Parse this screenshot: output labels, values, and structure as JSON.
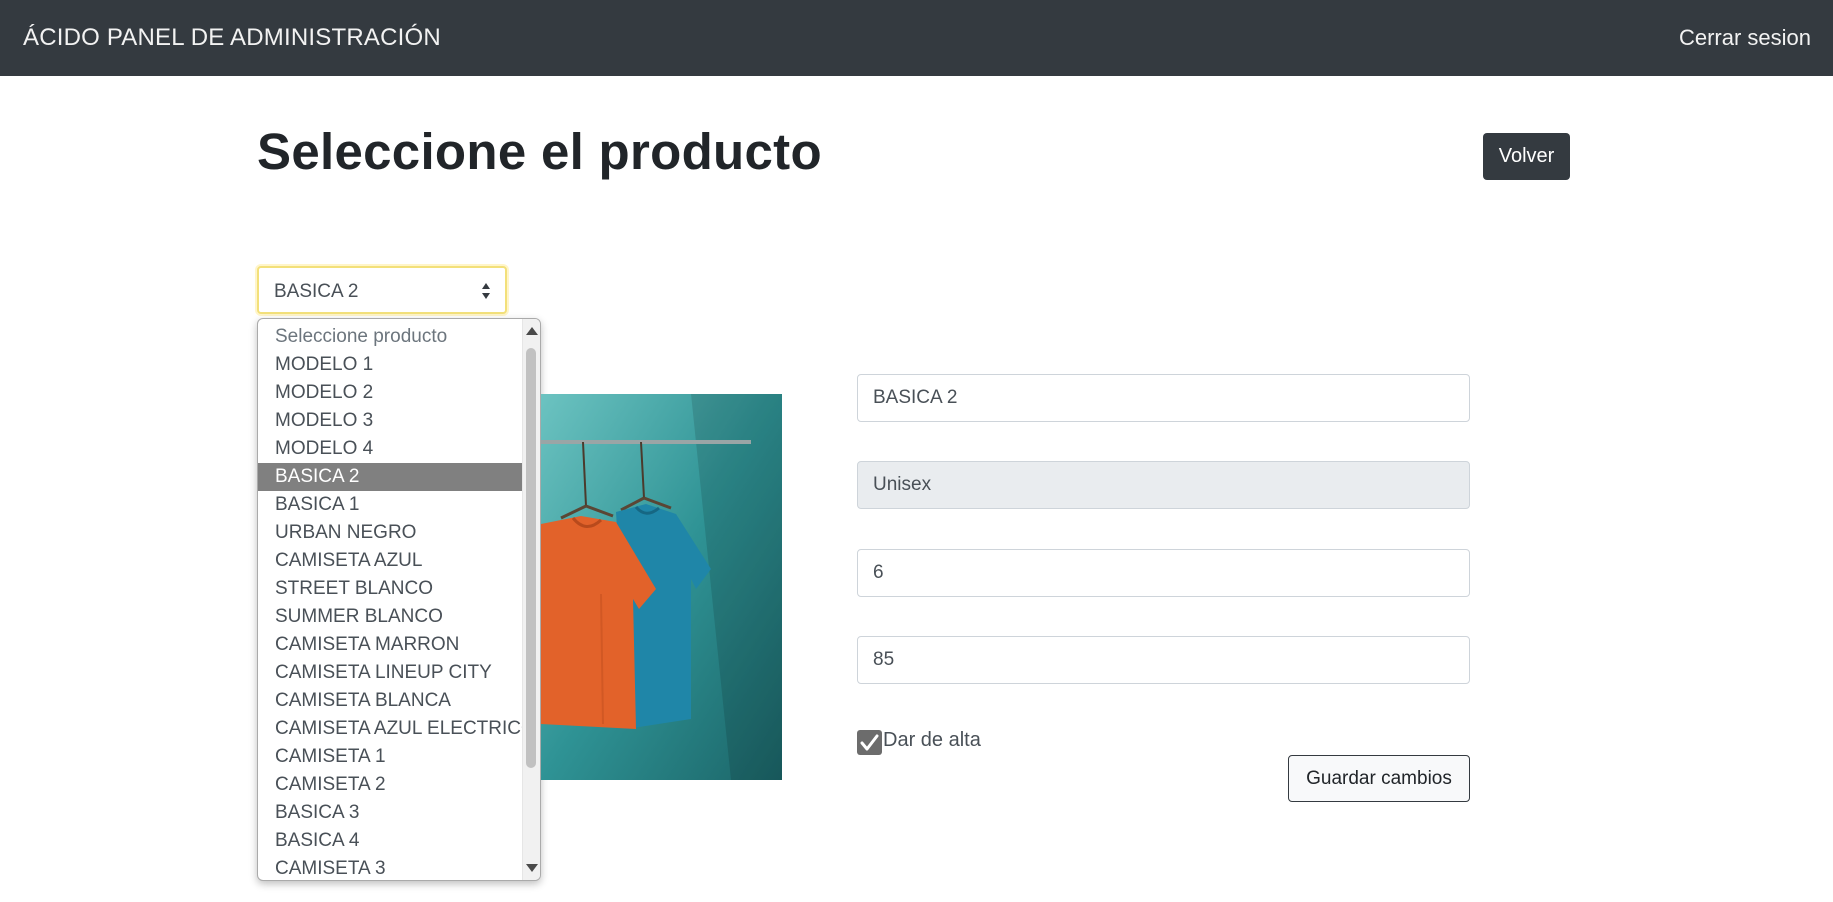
{
  "navbar": {
    "brand": "ÁCIDO PANEL DE ADMINISTRACIÓN",
    "logout_label": "Cerrar sesion"
  },
  "header": {
    "title": "Seleccione el producto",
    "back_label": "Volver"
  },
  "product_select": {
    "selected_value": "BASICA 2",
    "options": [
      "Seleccione producto",
      "MODELO 1",
      "MODELO 2",
      "MODELO 3",
      "MODELO 4",
      "BASICA 2",
      "BASICA 1",
      "URBAN NEGRO",
      "CAMISETA AZUL",
      "STREET BLANCO",
      "SUMMER BLANCO",
      "CAMISETA MARRON",
      "CAMISETA LINEUP CITY",
      "CAMISETA BLANCA",
      "CAMISETA AZUL ELECTRICO",
      "CAMISETA 1",
      "CAMISETA 2",
      "BASICA 3",
      "BASICA 4",
      "CAMISETA 3"
    ]
  },
  "form": {
    "name": "BASICA 2",
    "gender": "Unisex",
    "stock": "6",
    "price": "85",
    "active_label": "Dar de alta",
    "active_checked": true,
    "save_label": "Guardar cambios"
  },
  "colors": {
    "navbar": "#343a40",
    "focus_border": "#f3e07a",
    "selected_option": "#808080",
    "tshirt_orange": "#e2622a",
    "tshirt_blue": "#1f86a8"
  }
}
